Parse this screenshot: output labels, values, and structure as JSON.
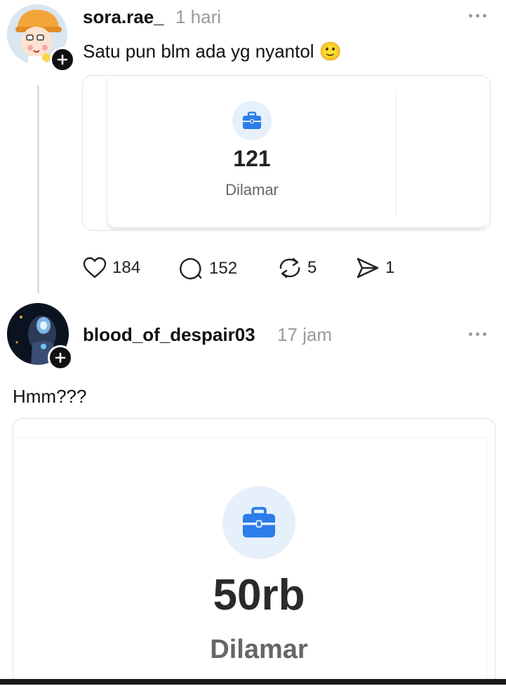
{
  "posts": [
    {
      "username": "sora.rae_",
      "time": "1 hari",
      "text": "Satu pun blm ada yg nyantol 🙂",
      "card": {
        "count": "121",
        "label": "Dilamar"
      },
      "actions": {
        "likes": "184",
        "comments": "152",
        "reposts": "5",
        "shares": "1"
      }
    },
    {
      "username": "blood_of_despair03",
      "time": "17 jam",
      "text": "Hmm???",
      "card": {
        "count": "50rb",
        "label": "Dilamar"
      }
    }
  ],
  "colors": {
    "accent": "#2b7de9",
    "icon_bg": "#e6f0fb",
    "muted": "#9a9a9a"
  },
  "icons": [
    "plus-icon",
    "more-icon",
    "briefcase-icon",
    "heart-icon",
    "comment-icon",
    "repost-icon",
    "share-icon"
  ]
}
